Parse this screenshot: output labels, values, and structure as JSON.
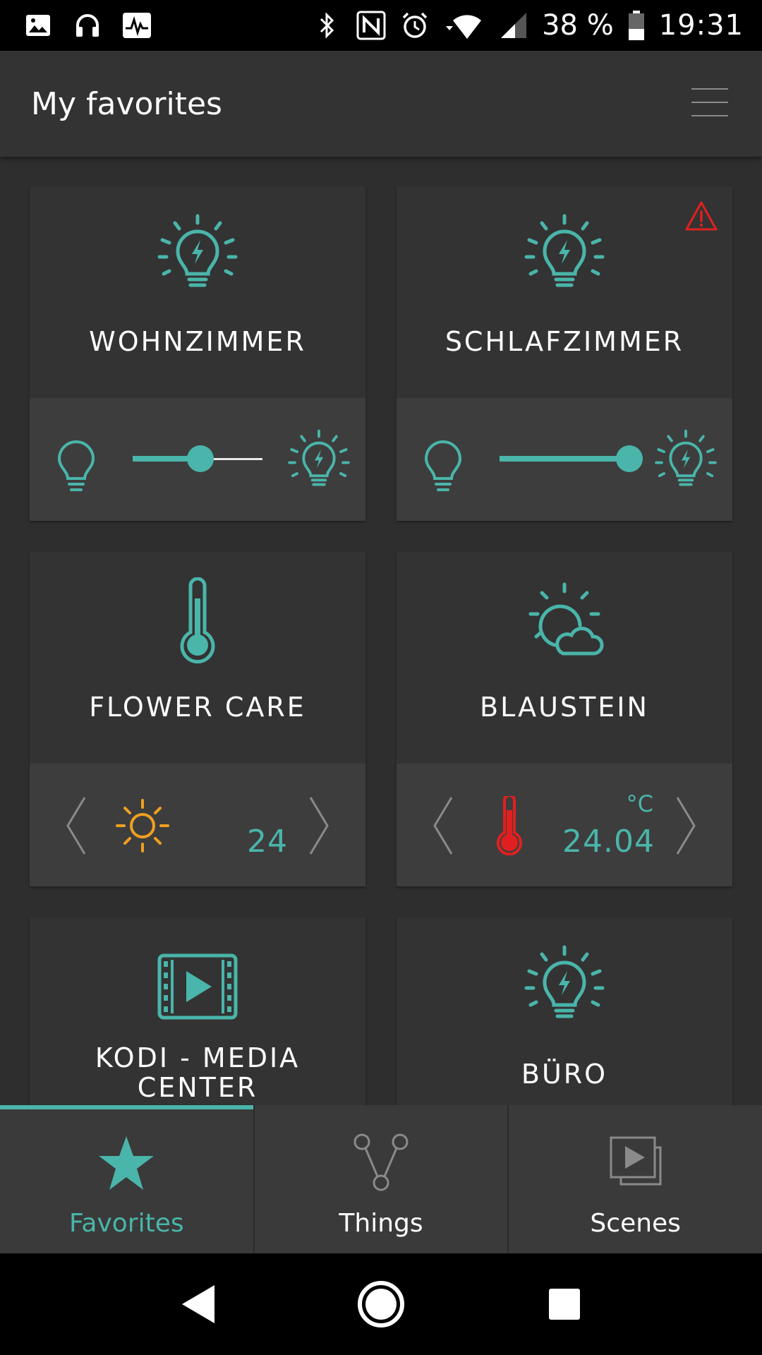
{
  "status_bar": {
    "battery_text": "38 %",
    "time": "19:31",
    "left_icons": [
      "image-icon",
      "headphones-icon",
      "activity-icon"
    ],
    "right_icons": [
      "bluetooth-icon",
      "nfc-icon",
      "alarm-icon",
      "wifi-icon",
      "signal-icon",
      "battery-icon"
    ]
  },
  "app_bar": {
    "title": "My favorites",
    "menu_icon": "hamburger-menu-icon"
  },
  "colors": {
    "accent": "#4ab5aa",
    "warning": "#e02020",
    "sun": "#f0a020",
    "background": "#2e2e2e",
    "card": "#333333",
    "card_bottom": "#3d3d3d"
  },
  "cards": [
    {
      "title": "WOHNZIMMER",
      "icon": "smart-bulb-icon",
      "warning": false,
      "control": "dimmer",
      "dimmer_level": 0.52
    },
    {
      "title": "SCHLAFZIMMER",
      "icon": "smart-bulb-icon",
      "warning": true,
      "control": "dimmer",
      "dimmer_level": 1.0
    },
    {
      "title": "FLOWER CARE",
      "icon": "thermometer-icon",
      "control": "sensor",
      "sensor_icon": "sun-icon",
      "value": "24",
      "unit": ""
    },
    {
      "title": "BLAUSTEIN",
      "icon": "weather-partly-cloudy-icon",
      "control": "sensor",
      "sensor_icon": "thermometer-red-icon",
      "value": "24.04",
      "unit": "°C"
    },
    {
      "title_line1": "KODI - MEDIA",
      "title_line2": "CENTER",
      "icon": "media-player-icon"
    },
    {
      "title": "BÜRO",
      "icon": "smart-bulb-icon"
    }
  ],
  "bottom_nav": {
    "tabs": [
      {
        "label": "Favorites",
        "icon": "star-icon",
        "active": true
      },
      {
        "label": "Things",
        "icon": "things-network-icon",
        "active": false
      },
      {
        "label": "Scenes",
        "icon": "scenes-icon",
        "active": false
      }
    ]
  },
  "system_nav": [
    "back-icon",
    "home-icon",
    "recents-icon"
  ]
}
